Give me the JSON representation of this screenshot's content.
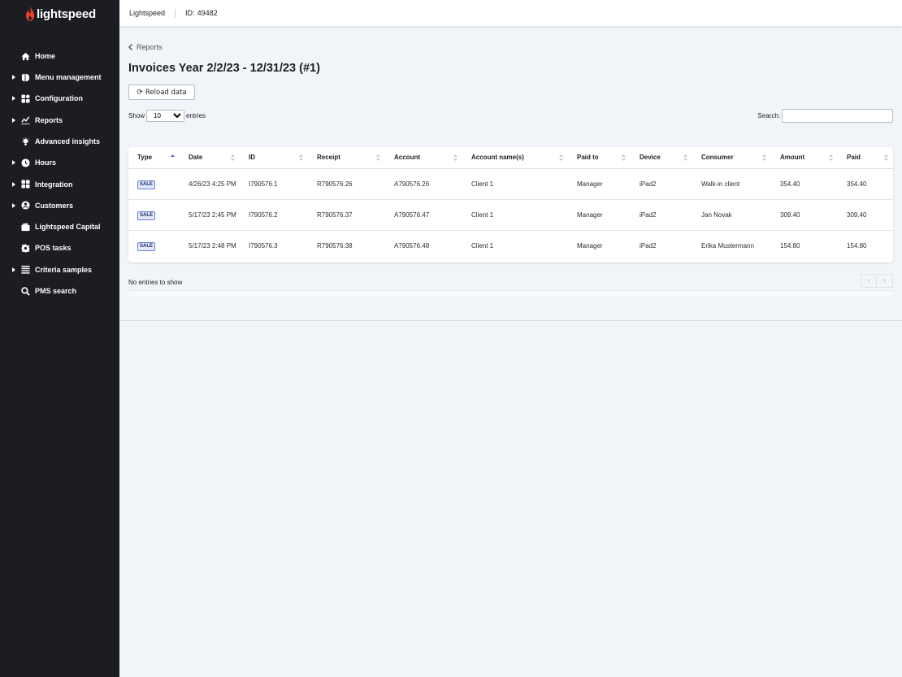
{
  "app": {
    "logo_text": "lightspeed",
    "colors": {
      "sidebar_bg": "#1b1d22",
      "brand": "#e8412c",
      "badge_border": "#6a7fd6"
    }
  },
  "sidebar": {
    "items": [
      {
        "label": "Home",
        "icon": "home-icon",
        "has_caret": false
      },
      {
        "label": "Menu management",
        "icon": "menu-management-icon",
        "has_caret": true
      },
      {
        "label": "Configuration",
        "icon": "grid-icon",
        "has_caret": true
      },
      {
        "label": "Reports",
        "icon": "chart-line-icon",
        "has_caret": true
      },
      {
        "label": "Advanced insights",
        "icon": "lightbulb-icon",
        "has_caret": false
      },
      {
        "label": "Hours",
        "icon": "clock-icon",
        "has_caret": true
      },
      {
        "label": "Integration",
        "icon": "puzzle-grid-icon",
        "has_caret": true
      },
      {
        "label": "Customers",
        "icon": "user-circle-icon",
        "has_caret": true
      },
      {
        "label": "Lightspeed Capital",
        "icon": "wallet-icon",
        "has_caret": false
      },
      {
        "label": "POS tasks",
        "icon": "gear-icon",
        "has_caret": false
      },
      {
        "label": "Criteria samples",
        "icon": "list-icon",
        "has_caret": true
      },
      {
        "label": "PMS search",
        "icon": "search-icon",
        "has_caret": false
      }
    ]
  },
  "topbar": {
    "company": "Lightspeed",
    "id_label": "ID:",
    "id_value": "49482"
  },
  "breadcrumb": {
    "label": "Reports"
  },
  "page": {
    "title": "Invoices Year 2/2/23 - 12/31/23 (#1)",
    "reload_label": "Reload data"
  },
  "length_control": {
    "show_label": "Show",
    "selected": "10",
    "entries_label": "entries"
  },
  "search": {
    "label": "Search:",
    "value": ""
  },
  "table": {
    "columns": [
      "Type",
      "Date",
      "ID",
      "Receipt",
      "Account",
      "Account name(s)",
      "Paid to",
      "Device",
      "Consumer",
      "Amount",
      "Paid"
    ],
    "sorted_column": "Type",
    "sort_direction": "asc",
    "rows": [
      {
        "type": "SALE",
        "date": "4/26/23 4:25 PM",
        "id": "I790576.1",
        "receipt": "R790576.26",
        "account": "A790576.26",
        "account_name": "Client 1",
        "paid_to": "Manager",
        "device": "iPad2",
        "consumer": "Walk-in client",
        "amount": "354.40",
        "paid": "354.40"
      },
      {
        "type": "SALE",
        "date": "5/17/23 2:45 PM",
        "id": "I790576.2",
        "receipt": "R790576.37",
        "account": "A790576.47",
        "account_name": "Client 1",
        "paid_to": "Manager",
        "device": "iPad2",
        "consumer": "Jan Novak",
        "amount": "309.40",
        "paid": "309.40"
      },
      {
        "type": "SALE",
        "date": "5/17/23 2:48 PM",
        "id": "I790576.3",
        "receipt": "R790576.38",
        "account": "A790576.48",
        "account_name": "Client 1",
        "paid_to": "Manager",
        "device": "iPad2",
        "consumer": "Erika Mustermann",
        "amount": "154.80",
        "paid": "154.80"
      }
    ]
  },
  "footer": {
    "info": "No entries to show",
    "prev_label": "‹",
    "next_label": "›"
  }
}
